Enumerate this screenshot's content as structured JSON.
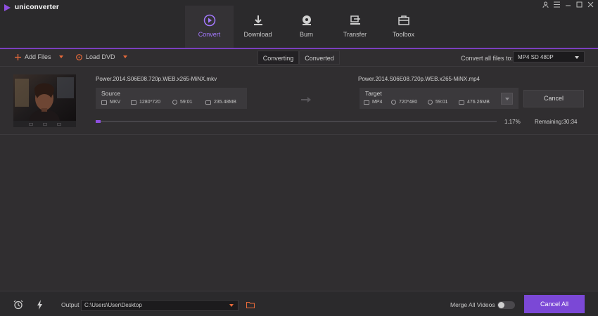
{
  "app": {
    "title": "uniconverter"
  },
  "window_controls": [
    "user-icon",
    "menu-icon",
    "minimize-icon",
    "maximize-icon",
    "close-icon"
  ],
  "nav": {
    "items": [
      {
        "label": "Convert",
        "icon": "convert-icon",
        "active": true
      },
      {
        "label": "Download",
        "icon": "download-icon",
        "active": false
      },
      {
        "label": "Burn",
        "icon": "burn-icon",
        "active": false
      },
      {
        "label": "Transfer",
        "icon": "transfer-icon",
        "active": false
      },
      {
        "label": "Toolbox",
        "icon": "toolbox-icon",
        "active": false
      }
    ]
  },
  "toolbar": {
    "add_files": "Add Files",
    "load_dvd": "Load DVD",
    "tabs": [
      "Converting",
      "Converted"
    ],
    "active_tab": "Converting",
    "convert_all_label": "Convert all files to:",
    "convert_all_value": "MP4 SD 480P"
  },
  "item": {
    "source_filename": "Power.2014.S06E08.720p.WEB.x265-MiNX.mkv",
    "target_filename": "Power.2014.S06E08.720p.WEB.x265-MiNX.mp4",
    "source": {
      "title": "Source",
      "format": "MKV",
      "resolution": "1280*720",
      "duration": "59:01",
      "size": "235.48MB"
    },
    "target": {
      "title": "Target",
      "format": "MP4",
      "resolution": "720*480",
      "duration": "59:01",
      "size": "476.26MB"
    },
    "cancel_label": "Cancel",
    "progress_percent": "1.17%",
    "progress_value": 1.17,
    "remaining": "Remaining:30:34"
  },
  "bottom": {
    "output_label": "Output",
    "output_path": "C:\\Users\\User\\Desktop",
    "merge_label": "Merge All Videos",
    "merge_enabled": false,
    "cancel_all_label": "Cancel All"
  },
  "colors": {
    "accent": "#7b48d6",
    "accent_light": "#a479ff",
    "orange": "#e86a3a",
    "background": "#302e30"
  }
}
